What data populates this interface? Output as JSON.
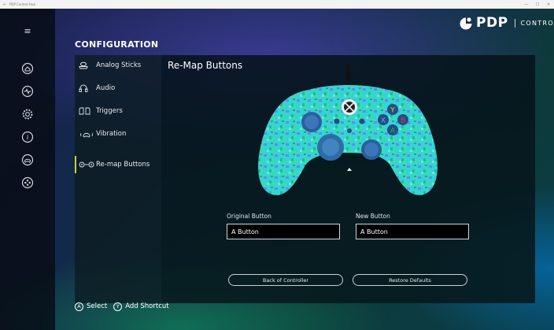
{
  "window": {
    "title": "PDP Control Hub",
    "back_icon": "←",
    "controls": [
      "—",
      "☐",
      "✕"
    ]
  },
  "logo": {
    "brand": "PDP",
    "product": "CONTROL HUB"
  },
  "rail": {
    "menu_glyph": "≡",
    "items": [
      "home-icon",
      "activity-icon",
      "settings-icon",
      "info-icon",
      "controller-icon",
      "gamepad-buttons-icon"
    ]
  },
  "section_title": "CONFIGURATION",
  "menu": {
    "items": [
      {
        "label": "Analog Sticks",
        "icon": "analog-stick-icon"
      },
      {
        "label": "Audio",
        "icon": "headset-icon"
      },
      {
        "label": "Triggers",
        "icon": "triggers-icon"
      },
      {
        "label": "Vibration",
        "icon": "vibration-icon"
      },
      {
        "label": "Re-map Buttons",
        "icon": "remap-icon",
        "active": true
      }
    ]
  },
  "remap": {
    "title": "Re-Map Buttons",
    "original_label": "Original Button",
    "original_value": "A Button",
    "new_label": "New Button",
    "new_value": "A Button",
    "back_button": "Back of Controller",
    "restore_button": "Restore Defaults"
  },
  "controller": {
    "face_buttons": {
      "y": "Y",
      "x": "X",
      "b": "B",
      "a": "A"
    }
  },
  "footer": {
    "select_key": "A",
    "select_label": "Select",
    "shortcut_key": "Y",
    "shortcut_label": "Add Shortcut"
  },
  "colors": {
    "accent": "#c7d230",
    "y_button": "#e6d23a",
    "x_button": "#2f7fe0",
    "b_button": "#e0353c",
    "a_button": "#2fb04a"
  }
}
